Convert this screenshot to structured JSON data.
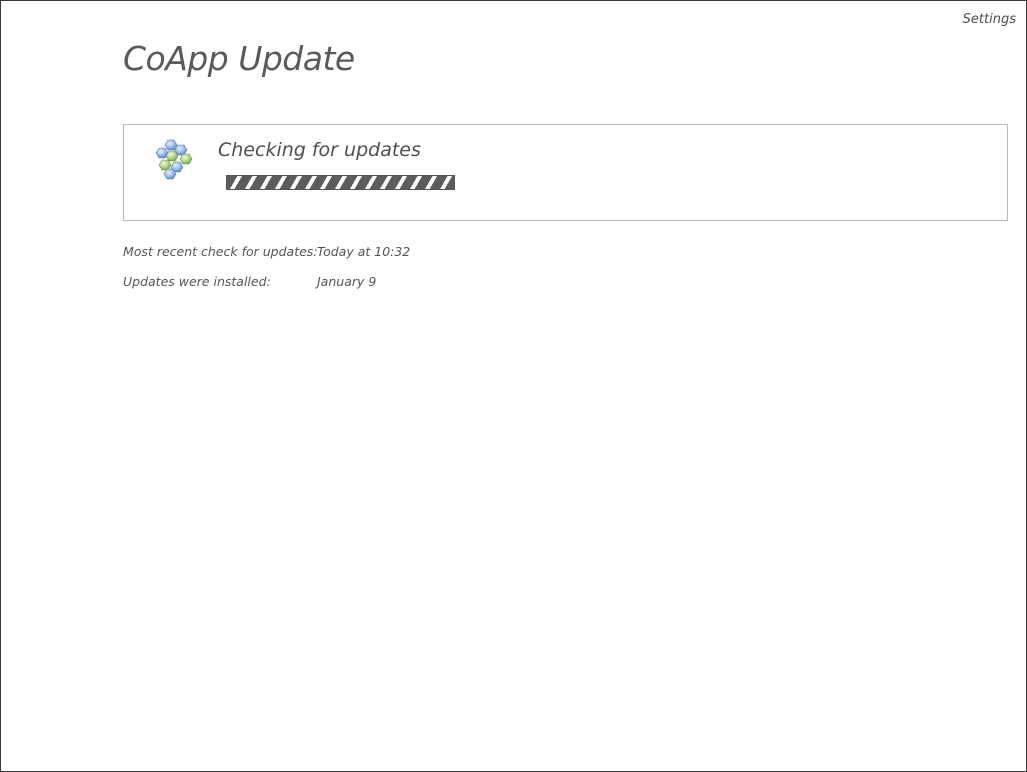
{
  "header": {
    "settings_label": "Settings",
    "title": "CoApp Update"
  },
  "status": {
    "title": "Checking for updates",
    "icon": "coapp-hexagon-cluster-icon",
    "progress_state": "indeterminate"
  },
  "info": {
    "last_check_label": "Most recent check for updates:",
    "last_check_value": "Today at 10:32",
    "installed_label": "Updates were installed:",
    "installed_value": "January 9"
  },
  "colors": {
    "text": "#555555",
    "border": "#b9b9b9",
    "progress": "#5c5c5c",
    "hex_blue": "#8fb6e6",
    "hex_green": "#a9cf7a"
  }
}
